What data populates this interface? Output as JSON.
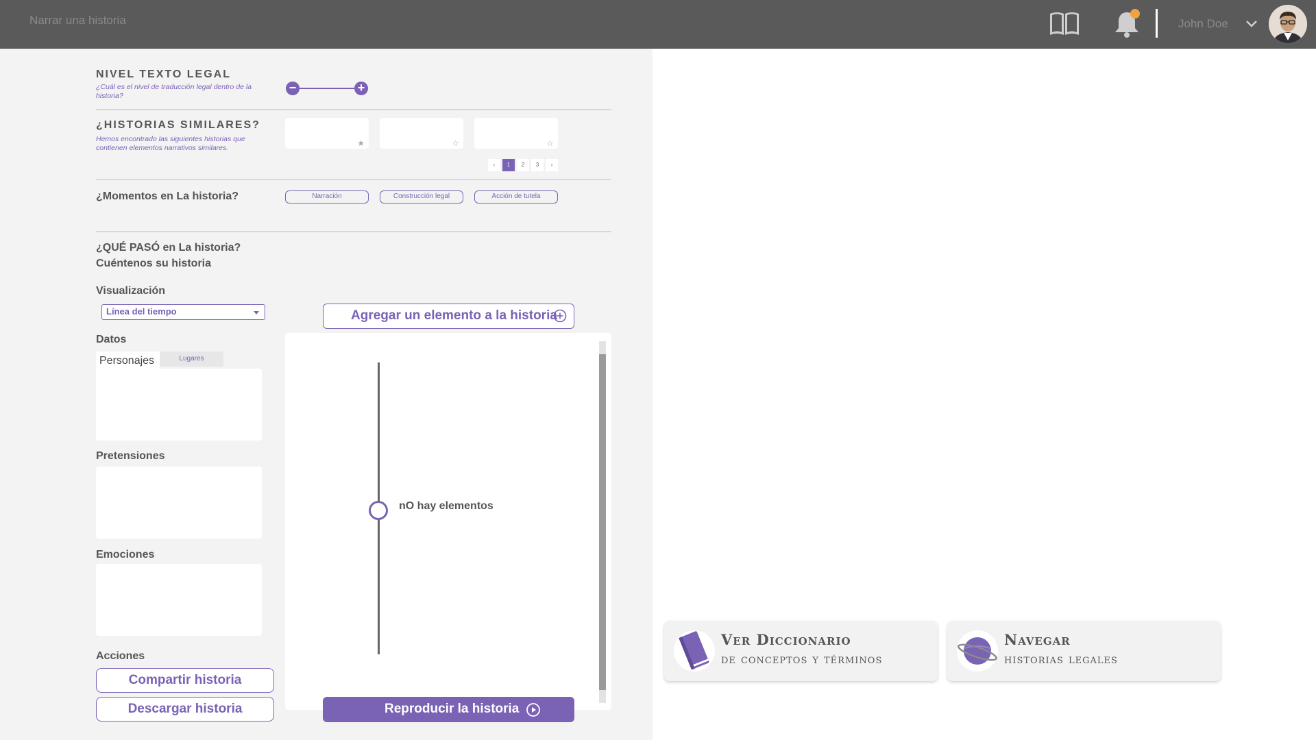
{
  "header": {
    "title": "Narrar una historia",
    "user_name": "John Doe",
    "icons": [
      "book-icon",
      "bell-icon",
      "chevron-down-icon"
    ],
    "notification_color": "#f0a340"
  },
  "legal_level": {
    "title": "NIVEL TEXTO LEGAL",
    "subtitle": "¿Cuál es el nivel de traducción legal dentro de la historia?"
  },
  "similar": {
    "title": "¿HISTORIAS SIMILARES?",
    "subtitle": "Hemos encontrado las siguientes historias que contienen elementos narrativos similares.",
    "stars": [
      "★",
      "☆",
      "☆"
    ],
    "pagination": {
      "prev": "‹",
      "pages": [
        "1",
        "2",
        "3"
      ],
      "next": "›",
      "current": "1"
    }
  },
  "moments": {
    "title": "¿Momentos en La historia?",
    "tags": [
      "Narración",
      "Construcción legal",
      "Acción de tutela"
    ]
  },
  "story": {
    "title_line1": "¿QUÉ PASÓ en La historia?",
    "title_line2": "Cuéntenos su historia",
    "visualization_label": "Visualización",
    "visualization_value": "Línea del tiempo",
    "data_label": "Datos",
    "tab_characters": "Personajes",
    "tab_places": "Lugares",
    "claims_label": "Pretensiones",
    "emotions_label": "Emociones",
    "actions_label": "Acciones",
    "share_button": "Compartir historia",
    "download_button": "Descargar historia",
    "add_element_button": "Agregar un elemento a la historia",
    "empty_timeline": "nO hay elementos",
    "play_button": "Reproducir la historia"
  },
  "cards": [
    {
      "title": "Ver Diccionario",
      "subtitle": "de conceptos y términos",
      "icon": "book-icon"
    },
    {
      "title": "Navegar",
      "subtitle": "historias legales",
      "icon": "planet-icon"
    }
  ],
  "colors": {
    "accent": "#7a62b5",
    "topbar": "#5a5a5a",
    "panel": "#f3f3f3"
  }
}
